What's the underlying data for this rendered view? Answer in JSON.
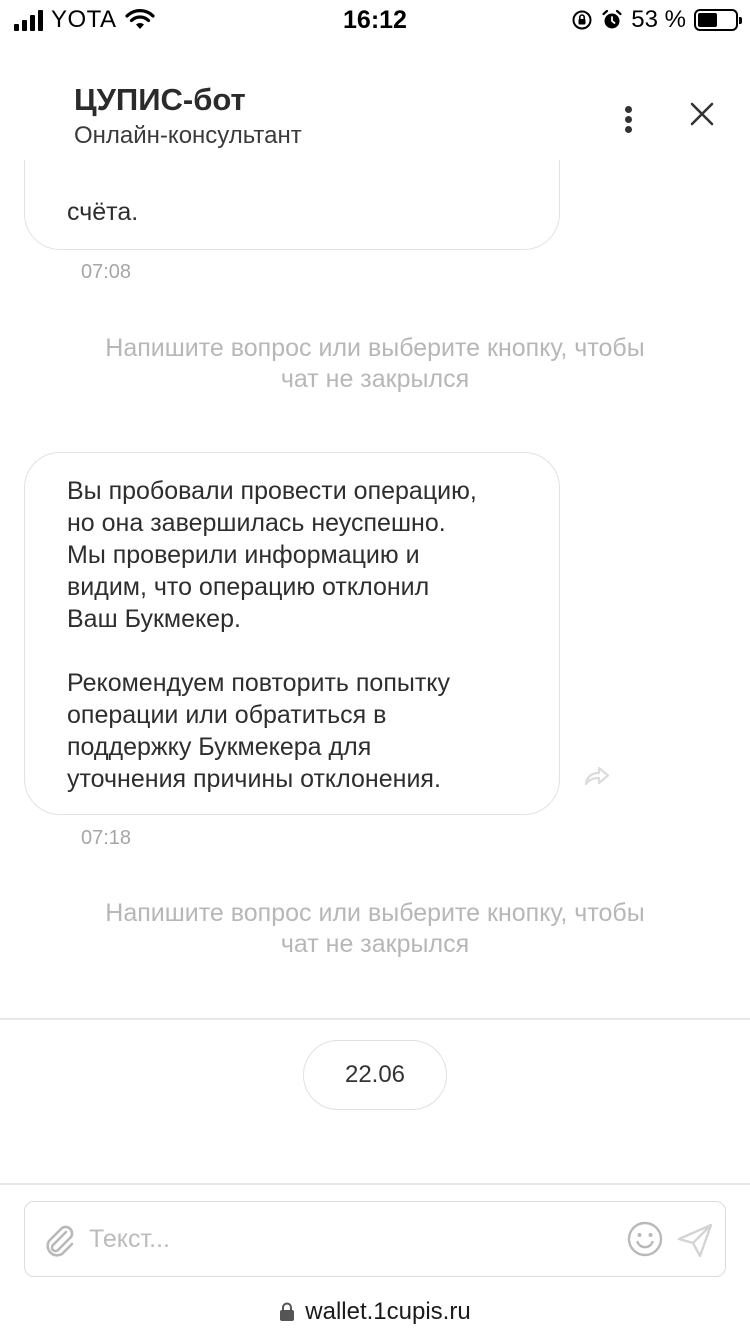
{
  "status_bar": {
    "carrier": "YOTA",
    "time": "16:12",
    "battery_percent": "53 %",
    "battery_level": 0.53
  },
  "header": {
    "title": "ЦУПИС-бот",
    "subtitle": "Онлайн-консультант"
  },
  "messages": [
    {
      "text": "счёта.",
      "time": "07:08"
    },
    {
      "text": "Вы пробовали провести операцию,\nно она завершилась неуспешно.\nМы проверили информацию и\nвидим, что операцию отклонил\nВаш Букмекер.\n\nРекомендуем повторить попытку\nоперации или обратиться в\nподдержку Букмекера для\nуточнения причины отклонения.",
      "time": "07:18"
    }
  ],
  "system_notes": [
    "Напишите вопрос или выберите кнопку, чтобы\nчат не закрылся",
    "Напишите вопрос или выберите кнопку, чтобы\nчат не закрылся"
  ],
  "date_chip": "22.06",
  "composer": {
    "placeholder": "Текст..."
  },
  "browser": {
    "url": "wallet.1cupis.ru"
  },
  "colors": {
    "bubble_border": "#e2e2e2",
    "muted_text": "#b7b7b7",
    "time_text": "#a6a6a6"
  }
}
